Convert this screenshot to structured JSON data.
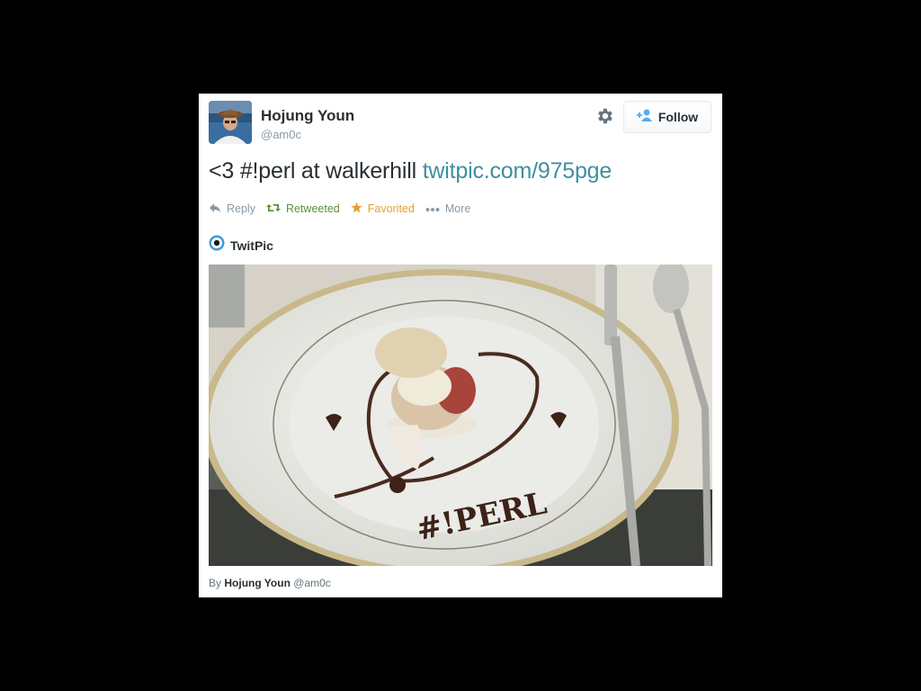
{
  "user": {
    "name": "Hojung Youn",
    "handle": "@am0c"
  },
  "follow_label": "Follow",
  "tweet": {
    "text": "<3 #!perl at walkerhill ",
    "link": "twitpic.com/975pge"
  },
  "actions": {
    "reply": "Reply",
    "retweet": "Retweeted",
    "favorite": "Favorited",
    "more": "More"
  },
  "media": {
    "provider": "TwitPic",
    "plate_text": "#!PERL"
  },
  "credit": {
    "prefix": "By",
    "name": "Hojung Youn",
    "handle": "@am0c"
  },
  "colors": {
    "link": "#3f8fa0",
    "retweeted": "#5c913b",
    "favorited": "#e5a02e",
    "muted": "#8899a6"
  },
  "icons": [
    "gear-icon",
    "add-user-icon",
    "reply-icon",
    "retweet-icon",
    "star-icon",
    "more-icon",
    "twitpic-icon"
  ]
}
